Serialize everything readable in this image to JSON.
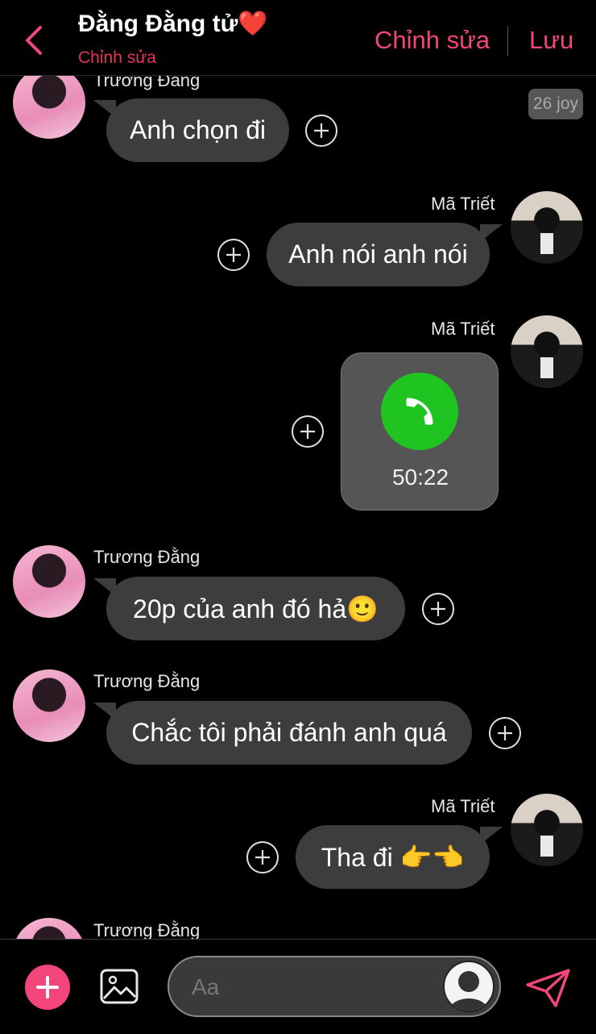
{
  "header": {
    "title": "Đằng Đằng tử❤️",
    "subtitle": "Chỉnh sửa",
    "edit_label": "Chỉnh sửa",
    "save_label": "Lưu"
  },
  "time_badge": "26 joy",
  "messages": [
    {
      "sender": "Trương Đằng",
      "side": "left",
      "text": "Anh chọn đi"
    },
    {
      "sender": "Mã Triết",
      "side": "right",
      "text": "Anh nói anh nói"
    },
    {
      "sender": "Mã Triết",
      "side": "right",
      "type": "call",
      "duration": "50:22"
    },
    {
      "sender": "Trương Đằng",
      "side": "left",
      "text": "20p của anh đó hả🙂"
    },
    {
      "sender": "Trương Đằng",
      "side": "left",
      "text": "Chắc tôi phải đánh anh quá"
    },
    {
      "sender": "Mã Triết",
      "side": "right",
      "text": "Tha đi 👉👈"
    },
    {
      "sender": "Trương Đằng",
      "side": "left"
    }
  ],
  "composer": {
    "placeholder": "Aa"
  },
  "colors": {
    "accent": "#f2457a",
    "subtitle": "#e8345a",
    "bubble": "#3d3d3d",
    "call_green": "#1fc421",
    "background": "#000000"
  },
  "icons": {
    "back": "chevron-left-icon",
    "plus": "plus-circle-icon",
    "call": "phone-icon",
    "add": "plus-icon",
    "image": "image-icon",
    "send": "send-icon"
  }
}
